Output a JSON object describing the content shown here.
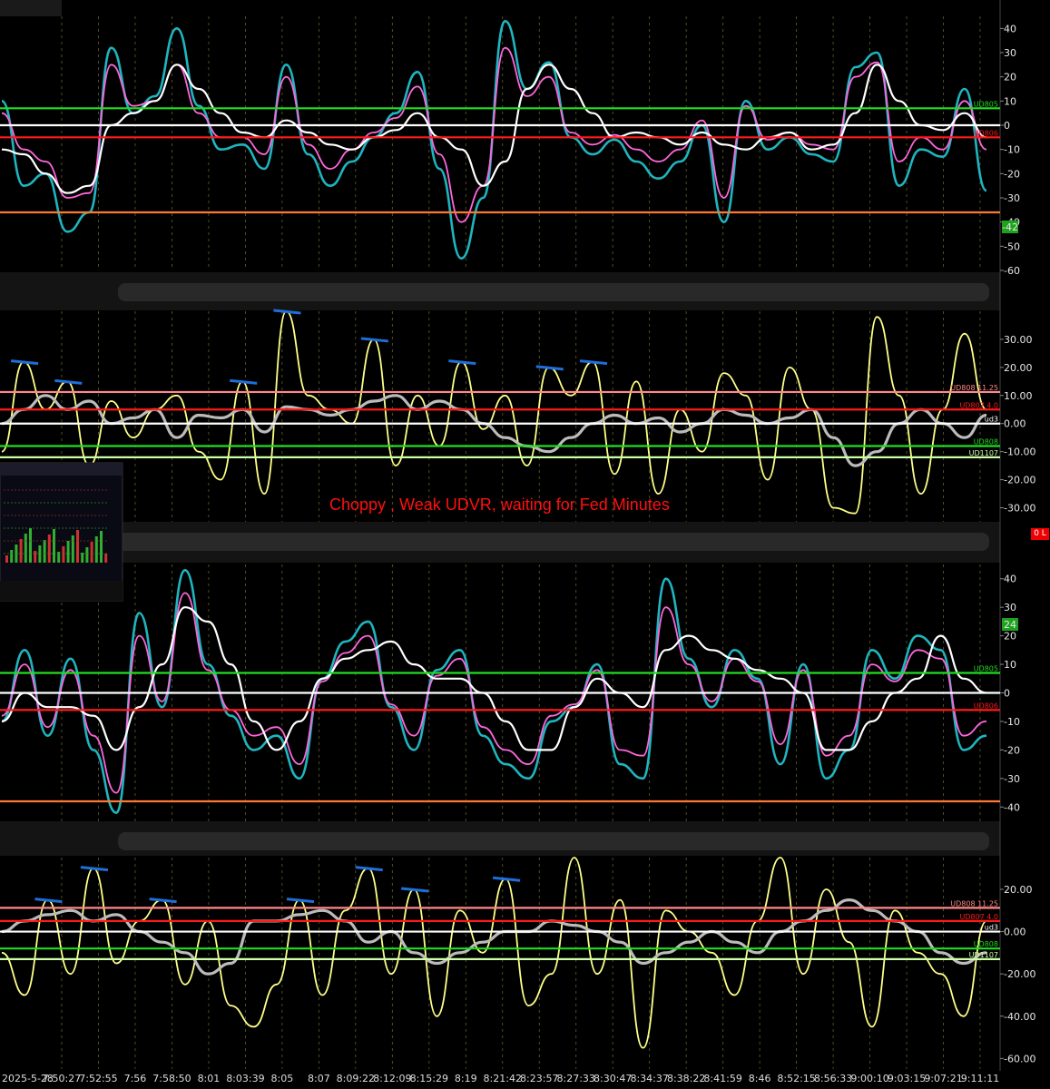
{
  "annotation": "Choppy , Weak UDVR, waiting for Fed Minutes",
  "date_label": "2025-5-28",
  "time_labels": [
    "7:50:27",
    "7:52:55",
    "7:56",
    "7:58:50",
    "8:01",
    "8:03:39",
    "8:05",
    "8:07",
    "8:09:22",
    "8:12:09",
    "8:15:29",
    "8:19",
    "8:21:42",
    "8:23:57",
    "8:27:33",
    "8:30:47",
    "8:34:37",
    "8:38:22",
    "8:41:59",
    "8:46",
    "8:52:15",
    "8:56:33",
    "9:00:10",
    "9:03:15",
    "9:07:21",
    "9:11:11"
  ],
  "zero_badge": "0 L",
  "colors": {
    "green": "#22dd22",
    "red": "#ff1a1a",
    "white": "#ffffff",
    "orange": "#ff7733",
    "cyan": "#1fb5bf",
    "magenta": "#ff66dd",
    "yellow": "#ffff88",
    "gray": "#bbbbbb",
    "salmon": "#ff8888",
    "lightgreen": "#ccffaa",
    "blue": "#1e6fd9"
  },
  "chart_data": [
    {
      "type": "line",
      "panel": "top oscillator",
      "ylim": [
        -60,
        45
      ],
      "yticks": [
        40,
        30,
        20,
        10,
        0,
        -10,
        -20,
        -30,
        -40,
        -50,
        -60
      ],
      "reference_lines": [
        {
          "value": 7,
          "color": "green",
          "label": "UD805"
        },
        {
          "value": 0,
          "color": "white",
          "label": ""
        },
        {
          "value": -5,
          "color": "red",
          "label": "UD806"
        },
        {
          "value": -36,
          "color": "orange",
          "label": ""
        }
      ],
      "last_value_badge": "-42",
      "series": [
        {
          "color": "cyan",
          "values": [
            10,
            -25,
            -20,
            -44,
            -36,
            32,
            5,
            12,
            40,
            8,
            -10,
            -8,
            -18,
            25,
            -12,
            -25,
            -15,
            -5,
            5,
            22,
            -18,
            -55,
            -30,
            43,
            15,
            26,
            -5,
            -12,
            -6,
            -15,
            -22,
            -15,
            0,
            -40,
            10,
            -10,
            -5,
            -12,
            -15,
            24,
            30,
            -25,
            -10,
            -13,
            15,
            -27
          ]
        },
        {
          "color": "magenta",
          "values": [
            5,
            -10,
            -15,
            -30,
            -28,
            25,
            8,
            10,
            25,
            5,
            -5,
            -5,
            -12,
            20,
            -8,
            -18,
            -10,
            -3,
            3,
            16,
            -12,
            -40,
            -25,
            32,
            12,
            20,
            -3,
            -8,
            -4,
            -10,
            -15,
            -10,
            2,
            -30,
            8,
            -6,
            -3,
            -8,
            -10,
            20,
            26,
            -15,
            -5,
            -10,
            10,
            -10
          ]
        },
        {
          "color": "white",
          "values": [
            -10,
            -12,
            -20,
            -28,
            -25,
            0,
            5,
            10,
            25,
            15,
            5,
            -3,
            -5,
            2,
            -3,
            -8,
            -10,
            -5,
            -2,
            5,
            -5,
            -10,
            -25,
            -15,
            15,
            25,
            15,
            5,
            -5,
            -3,
            -5,
            -8,
            -3,
            -8,
            -10,
            -5,
            -3,
            -10,
            -8,
            5,
            25,
            10,
            0,
            -2,
            5,
            -5
          ]
        }
      ]
    },
    {
      "type": "line",
      "panel": "second oscillator",
      "ylim": [
        -35,
        40
      ],
      "yticks": [
        30,
        20,
        10,
        0,
        -10,
        -20,
        -30
      ],
      "tick_labels": [
        "30.00",
        "20.00",
        "10.00",
        "0.00",
        "-10.00",
        "-20.00",
        "-30.00"
      ],
      "reference_lines": [
        {
          "value": 11.25,
          "color": "salmon",
          "label": "UD808  11.25"
        },
        {
          "value": 5,
          "color": "red",
          "label": "UD807  4.0"
        },
        {
          "value": 0,
          "color": "white",
          "label": "ud3"
        },
        {
          "value": -8,
          "color": "green",
          "label": "UD808"
        },
        {
          "value": -12,
          "color": "lightgreen",
          "label": "UD1107"
        }
      ],
      "series": [
        {
          "color": "yellow",
          "values": [
            -10,
            22,
            5,
            15,
            -15,
            8,
            -5,
            5,
            10,
            -10,
            -20,
            15,
            -25,
            40,
            10,
            5,
            0,
            30,
            -15,
            10,
            -8,
            22,
            -2,
            10,
            -15,
            20,
            10,
            22,
            -18,
            15,
            -25,
            5,
            -10,
            18,
            10,
            -20,
            20,
            5,
            -30,
            -32,
            38,
            10,
            -25,
            5,
            32,
            5
          ]
        },
        {
          "color": "gray",
          "values": [
            0,
            5,
            10,
            5,
            8,
            0,
            2,
            5,
            -5,
            3,
            2,
            5,
            -3,
            6,
            5,
            3,
            5,
            8,
            10,
            5,
            8,
            5,
            0,
            -5,
            -8,
            -10,
            -5,
            0,
            3,
            0,
            2,
            -3,
            0,
            5,
            3,
            0,
            2,
            5,
            -5,
            -15,
            -10,
            0,
            5,
            0,
            -5,
            3
          ]
        }
      ],
      "trend_segments": 8
    },
    {
      "type": "line",
      "panel": "third oscillator",
      "ylim": [
        -45,
        45
      ],
      "yticks": [
        40,
        30,
        20,
        10,
        0,
        -10,
        -20,
        -30,
        -40
      ],
      "reference_lines": [
        {
          "value": 7,
          "color": "green",
          "label": "UD805"
        },
        {
          "value": 0,
          "color": "white",
          "label": ""
        },
        {
          "value": -6,
          "color": "red",
          "label": "UD806"
        },
        {
          "value": -38,
          "color": "orange",
          "label": ""
        }
      ],
      "last_value_badge": "24",
      "series": [
        {
          "color": "cyan",
          "values": [
            -10,
            15,
            -15,
            12,
            -20,
            -42,
            28,
            -5,
            43,
            10,
            -8,
            -20,
            -15,
            -30,
            5,
            18,
            25,
            -5,
            -20,
            8,
            15,
            -15,
            -25,
            -30,
            -10,
            -5,
            10,
            -25,
            -30,
            40,
            12,
            -5,
            15,
            5,
            -25,
            10,
            -30,
            -20,
            15,
            5,
            20,
            15,
            -20,
            -15
          ]
        },
        {
          "color": "magenta",
          "values": [
            -8,
            10,
            -12,
            8,
            -15,
            -35,
            20,
            -3,
            35,
            8,
            -6,
            -15,
            -12,
            -25,
            4,
            14,
            20,
            -4,
            -15,
            6,
            12,
            -12,
            -20,
            -25,
            -8,
            -4,
            8,
            -20,
            -22,
            30,
            10,
            -3,
            12,
            4,
            -18,
            8,
            -22,
            -15,
            10,
            4,
            15,
            12,
            -15,
            -10
          ]
        },
        {
          "color": "white",
          "values": [
            -10,
            0,
            -5,
            -5,
            -8,
            -20,
            -5,
            10,
            30,
            25,
            10,
            -10,
            -20,
            -10,
            5,
            12,
            15,
            18,
            10,
            5,
            5,
            0,
            -10,
            -20,
            -20,
            -5,
            5,
            0,
            -5,
            15,
            20,
            15,
            12,
            8,
            5,
            0,
            -20,
            -20,
            -10,
            0,
            5,
            20,
            5,
            0
          ]
        }
      ]
    },
    {
      "type": "line",
      "panel": "bottom oscillator",
      "ylim": [
        -65,
        35
      ],
      "yticks": [
        20,
        0,
        -20,
        -40,
        -60
      ],
      "tick_labels": [
        "20.00",
        "0.00",
        "-20.00",
        "-40.00",
        "-60.00"
      ],
      "reference_lines": [
        {
          "value": 11.25,
          "color": "salmon",
          "label": "UD808  11.25"
        },
        {
          "value": 5,
          "color": "red",
          "label": "UD807  4.0"
        },
        {
          "value": 0,
          "color": "white",
          "label": "ud3"
        },
        {
          "value": -8,
          "color": "green",
          "label": "UD808"
        },
        {
          "value": -13,
          "color": "lightgreen",
          "label": "UD1107"
        }
      ],
      "series": [
        {
          "color": "yellow",
          "values": [
            -10,
            -30,
            15,
            -20,
            30,
            -15,
            5,
            15,
            -25,
            5,
            -35,
            -45,
            -25,
            15,
            -30,
            10,
            30,
            -20,
            20,
            -40,
            10,
            -10,
            25,
            -35,
            -20,
            35,
            -20,
            15,
            -55,
            10,
            0,
            -10,
            -30,
            5,
            35,
            -20,
            20,
            -5,
            -45,
            10,
            -10,
            -20,
            -40,
            5
          ]
        },
        {
          "color": "gray",
          "values": [
            0,
            5,
            8,
            10,
            5,
            8,
            0,
            -5,
            -10,
            -20,
            -15,
            5,
            5,
            8,
            10,
            5,
            -5,
            0,
            -10,
            -15,
            -10,
            -5,
            0,
            0,
            5,
            3,
            0,
            -5,
            -15,
            -10,
            -5,
            0,
            -5,
            -10,
            0,
            5,
            10,
            15,
            10,
            5,
            0,
            -10,
            -15,
            -10
          ]
        }
      ],
      "trend_segments": 7
    }
  ]
}
